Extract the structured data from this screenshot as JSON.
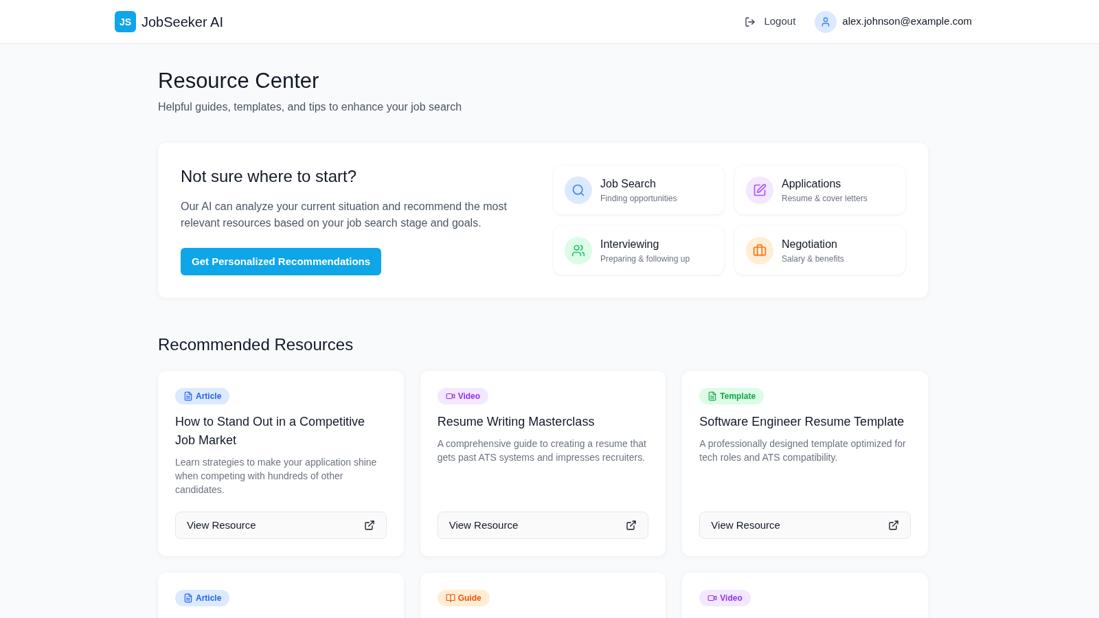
{
  "header": {
    "logo_mark": "JS",
    "app_name": "JobSeeker AI",
    "logout": "Logout",
    "user_email": "alex.johnson@example.com"
  },
  "page": {
    "title": "Resource Center",
    "subtitle": "Helpful guides, templates, and tips to enhance your job search"
  },
  "hero": {
    "title": "Not sure where to start?",
    "text": "Our AI can analyze your current situation and recommend the most relevant resources based on your job search stage and goals.",
    "button": "Get Personalized Recommendations",
    "categories": [
      {
        "kind": "search",
        "title": "Job Search",
        "subtitle": "Finding opportunities"
      },
      {
        "kind": "edit",
        "title": "Applications",
        "subtitle": "Resume & cover letters"
      },
      {
        "kind": "people",
        "title": "Interviewing",
        "subtitle": "Preparing & following up"
      },
      {
        "kind": "briefcase",
        "title": "Negotiation",
        "subtitle": "Salary & benefits"
      }
    ]
  },
  "recommended": {
    "title": "Recommended Resources",
    "resources": [
      {
        "kind": "article",
        "badge": "Article",
        "title": "How to Stand Out in a Competitive Job Market",
        "description": "Learn strategies to make your application shine when competing with hundreds of other candidates.",
        "button": "View Resource"
      },
      {
        "kind": "video",
        "badge": "Video",
        "title": "Resume Writing Masterclass",
        "description": "A comprehensive guide to creating a resume that gets past ATS systems and impresses recruiters.",
        "button": "View Resource"
      },
      {
        "kind": "template",
        "badge": "Template",
        "title": "Software Engineer Resume Template",
        "description": "A professionally designed template optimized for tech roles and ATS compatibility.",
        "button": "View Resource"
      },
      {
        "kind": "article",
        "badge": "Article"
      },
      {
        "kind": "guide",
        "badge": "Guide"
      },
      {
        "kind": "video",
        "badge": "Video"
      }
    ]
  }
}
